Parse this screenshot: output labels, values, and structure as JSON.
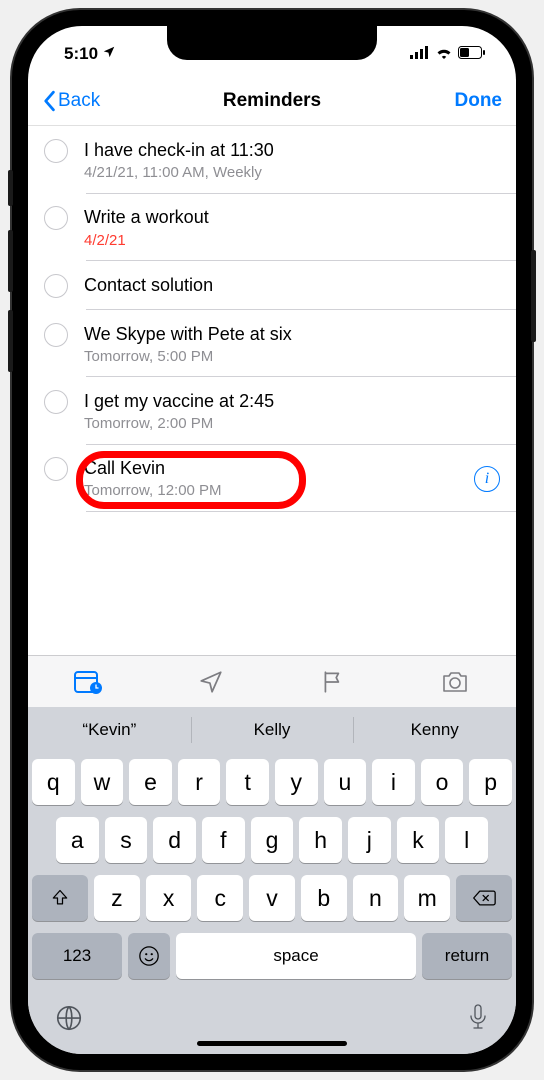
{
  "status": {
    "time": "5:10"
  },
  "nav": {
    "back": "Back",
    "title": "Reminders",
    "done": "Done"
  },
  "reminders": [
    {
      "title": "I have check-in at 11:30",
      "sub": "4/21/21, 11:00 AM, Weekly",
      "overdue": false,
      "selected": false
    },
    {
      "title": "Write a workout",
      "sub": "4/2/21",
      "overdue": true,
      "selected": false
    },
    {
      "title": "Contact solution",
      "sub": "",
      "overdue": false,
      "selected": false
    },
    {
      "title": "We Skype with Pete at six",
      "sub": "Tomorrow, 5:00 PM",
      "overdue": false,
      "selected": false
    },
    {
      "title": "I get my vaccine at 2:45",
      "sub": "Tomorrow, 2:00 PM",
      "overdue": false,
      "selected": false
    },
    {
      "title": "Call Kevin",
      "sub": "Tomorrow, 12:00 PM",
      "overdue": false,
      "selected": true
    }
  ],
  "annotation": {
    "highlightIndex": 5
  },
  "toolbar": {
    "calendar": "calendar-clock-icon",
    "location": "location-arrow-icon",
    "flag": "flag-icon",
    "photo": "camera-icon"
  },
  "keyboard": {
    "suggestions": [
      "“Kevin”",
      "Kelly",
      "Kenny"
    ],
    "row1": [
      "q",
      "w",
      "e",
      "r",
      "t",
      "y",
      "u",
      "i",
      "o",
      "p"
    ],
    "row2": [
      "a",
      "s",
      "d",
      "f",
      "g",
      "h",
      "j",
      "k",
      "l"
    ],
    "row3": [
      "z",
      "x",
      "c",
      "v",
      "b",
      "n",
      "m"
    ],
    "numKey": "123",
    "space": "space",
    "returnKey": "return"
  }
}
